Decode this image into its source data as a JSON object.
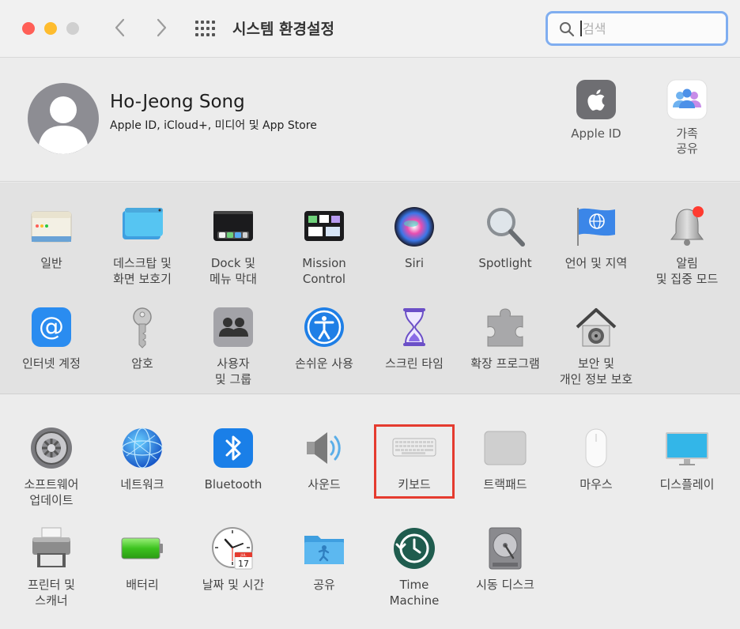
{
  "window": {
    "title": "시스템 환경설정"
  },
  "search": {
    "placeholder": "검색",
    "value": ""
  },
  "account": {
    "name": "Ho-Jeong Song",
    "subtitle": "Apple ID, iCloud+, 미디어 및 App Store",
    "items": [
      {
        "id": "apple-id",
        "label": "Apple ID"
      },
      {
        "id": "family-sharing",
        "label": "가족\n공유"
      }
    ]
  },
  "section1": [
    {
      "id": "general",
      "label": "일반",
      "icon": "general-icon"
    },
    {
      "id": "desktop-screensaver",
      "label": "데스크탑 및\n화면 보호기",
      "icon": "desktop-screensaver-icon"
    },
    {
      "id": "dock-menubar",
      "label": "Dock 및\n메뉴 막대",
      "icon": "dock-icon"
    },
    {
      "id": "mission-control",
      "label": "Mission\nControl",
      "icon": "mission-control-icon"
    },
    {
      "id": "siri",
      "label": "Siri",
      "icon": "siri-icon"
    },
    {
      "id": "spotlight",
      "label": "Spotlight",
      "icon": "spotlight-icon"
    },
    {
      "id": "language-region",
      "label": "언어 및 지역",
      "icon": "globe-flag-icon"
    },
    {
      "id": "notifications-focus",
      "label": "알림\n및 집중 모드",
      "icon": "bell-icon"
    },
    {
      "id": "internet-accounts",
      "label": "인터넷 계정",
      "icon": "at-sign-icon"
    },
    {
      "id": "passwords",
      "label": "암호",
      "icon": "key-icon"
    },
    {
      "id": "users-groups",
      "label": "사용자\n및 그룹",
      "icon": "users-icon"
    },
    {
      "id": "accessibility",
      "label": "손쉬운 사용",
      "icon": "accessibility-icon"
    },
    {
      "id": "screen-time",
      "label": "스크린 타임",
      "icon": "hourglass-icon"
    },
    {
      "id": "extensions",
      "label": "확장 프로그램",
      "icon": "puzzle-icon"
    },
    {
      "id": "security-privacy",
      "label": "보안 및\n개인 정보 보호",
      "icon": "house-lock-icon"
    }
  ],
  "section2": [
    {
      "id": "software-update",
      "label": "소프트웨어\n업데이트",
      "icon": "gear-icon"
    },
    {
      "id": "network",
      "label": "네트워크",
      "icon": "network-globe-icon"
    },
    {
      "id": "bluetooth",
      "label": "Bluetooth",
      "icon": "bluetooth-icon"
    },
    {
      "id": "sound",
      "label": "사운드",
      "icon": "speaker-icon"
    },
    {
      "id": "keyboard",
      "label": "키보드",
      "icon": "keyboard-icon"
    },
    {
      "id": "trackpad",
      "label": "트랙패드",
      "icon": "trackpad-icon"
    },
    {
      "id": "mouse",
      "label": "마우스",
      "icon": "mouse-icon"
    },
    {
      "id": "displays",
      "label": "디스플레이",
      "icon": "display-icon"
    },
    {
      "id": "printers-scanners",
      "label": "프린터 및\n스캐너",
      "icon": "printer-icon"
    },
    {
      "id": "battery",
      "label": "배터리",
      "icon": "battery-icon"
    },
    {
      "id": "date-time",
      "label": "날짜 및 시간",
      "icon": "clock-icon",
      "calendar_day": "17",
      "calendar_month": "JUL"
    },
    {
      "id": "sharing",
      "label": "공유",
      "icon": "sharing-folder-icon"
    },
    {
      "id": "time-machine",
      "label": "Time\nMachine",
      "icon": "time-machine-icon"
    },
    {
      "id": "startup-disk",
      "label": "시동 디스크",
      "icon": "disk-icon"
    }
  ],
  "colors": {
    "highlight": "#e53b2f",
    "search_focus": "#80aef0",
    "close": "#ff5f57",
    "minimize": "#febc2e"
  }
}
